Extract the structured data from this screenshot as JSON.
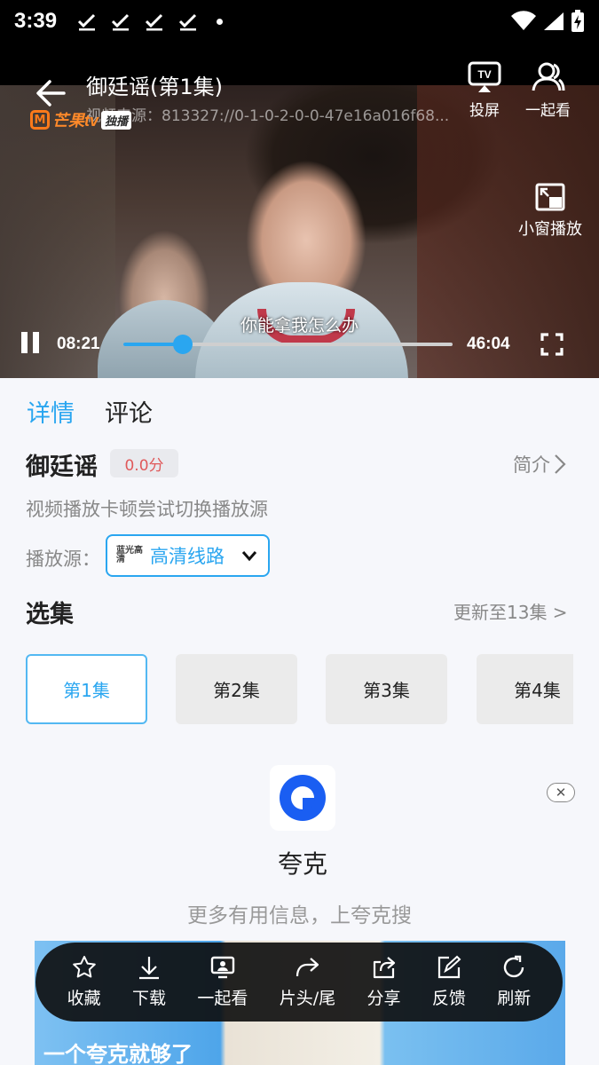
{
  "status_bar": {
    "time": "3:39"
  },
  "player": {
    "title": "御廷谣(第1集)",
    "source_url": "视频来源：813327://0-1-0-2-0-0-47e16a016f68...",
    "logo_text": "芒果tv",
    "logo_badge": "独播",
    "cast_label": "投屏",
    "watch_together_label": "一起看",
    "pip_label": "小窗播放",
    "subtitle": "你能拿我怎么办",
    "current_time": "08:21",
    "total_time": "46:04",
    "progress_fraction": 0.181
  },
  "tabs": [
    {
      "label": "详情"
    },
    {
      "label": "评论"
    }
  ],
  "show": {
    "title": "御廷谣",
    "score": "0.0分",
    "intro_label": "简介",
    "tip": "视频播放卡顿尝试切换播放源",
    "source_label": "播放源：",
    "source_badge": "蓝光高清",
    "source_value": "高清线路"
  },
  "episodes": {
    "title": "选集",
    "update_label": "更新至13集 >",
    "items": [
      "第1集",
      "第2集",
      "第3集",
      "第4集"
    ]
  },
  "ad": {
    "name": "夸克",
    "tagline": "更多有用信息，上夸克搜",
    "close_label": "✕",
    "banner_text": "一个夸克就够了"
  },
  "toolbar": {
    "items": [
      {
        "label": "收藏",
        "icon": "star-icon"
      },
      {
        "label": "下载",
        "icon": "download-icon"
      },
      {
        "label": "一起看",
        "icon": "screen-people-icon"
      },
      {
        "label": "片头/尾",
        "icon": "skip-arrow-icon"
      },
      {
        "label": "分享",
        "icon": "share-icon"
      },
      {
        "label": "反馈",
        "icon": "edit-icon"
      },
      {
        "label": "刷新",
        "icon": "refresh-icon"
      }
    ]
  },
  "colors": {
    "accent": "#2aa6f0",
    "score": "#e0595a"
  }
}
